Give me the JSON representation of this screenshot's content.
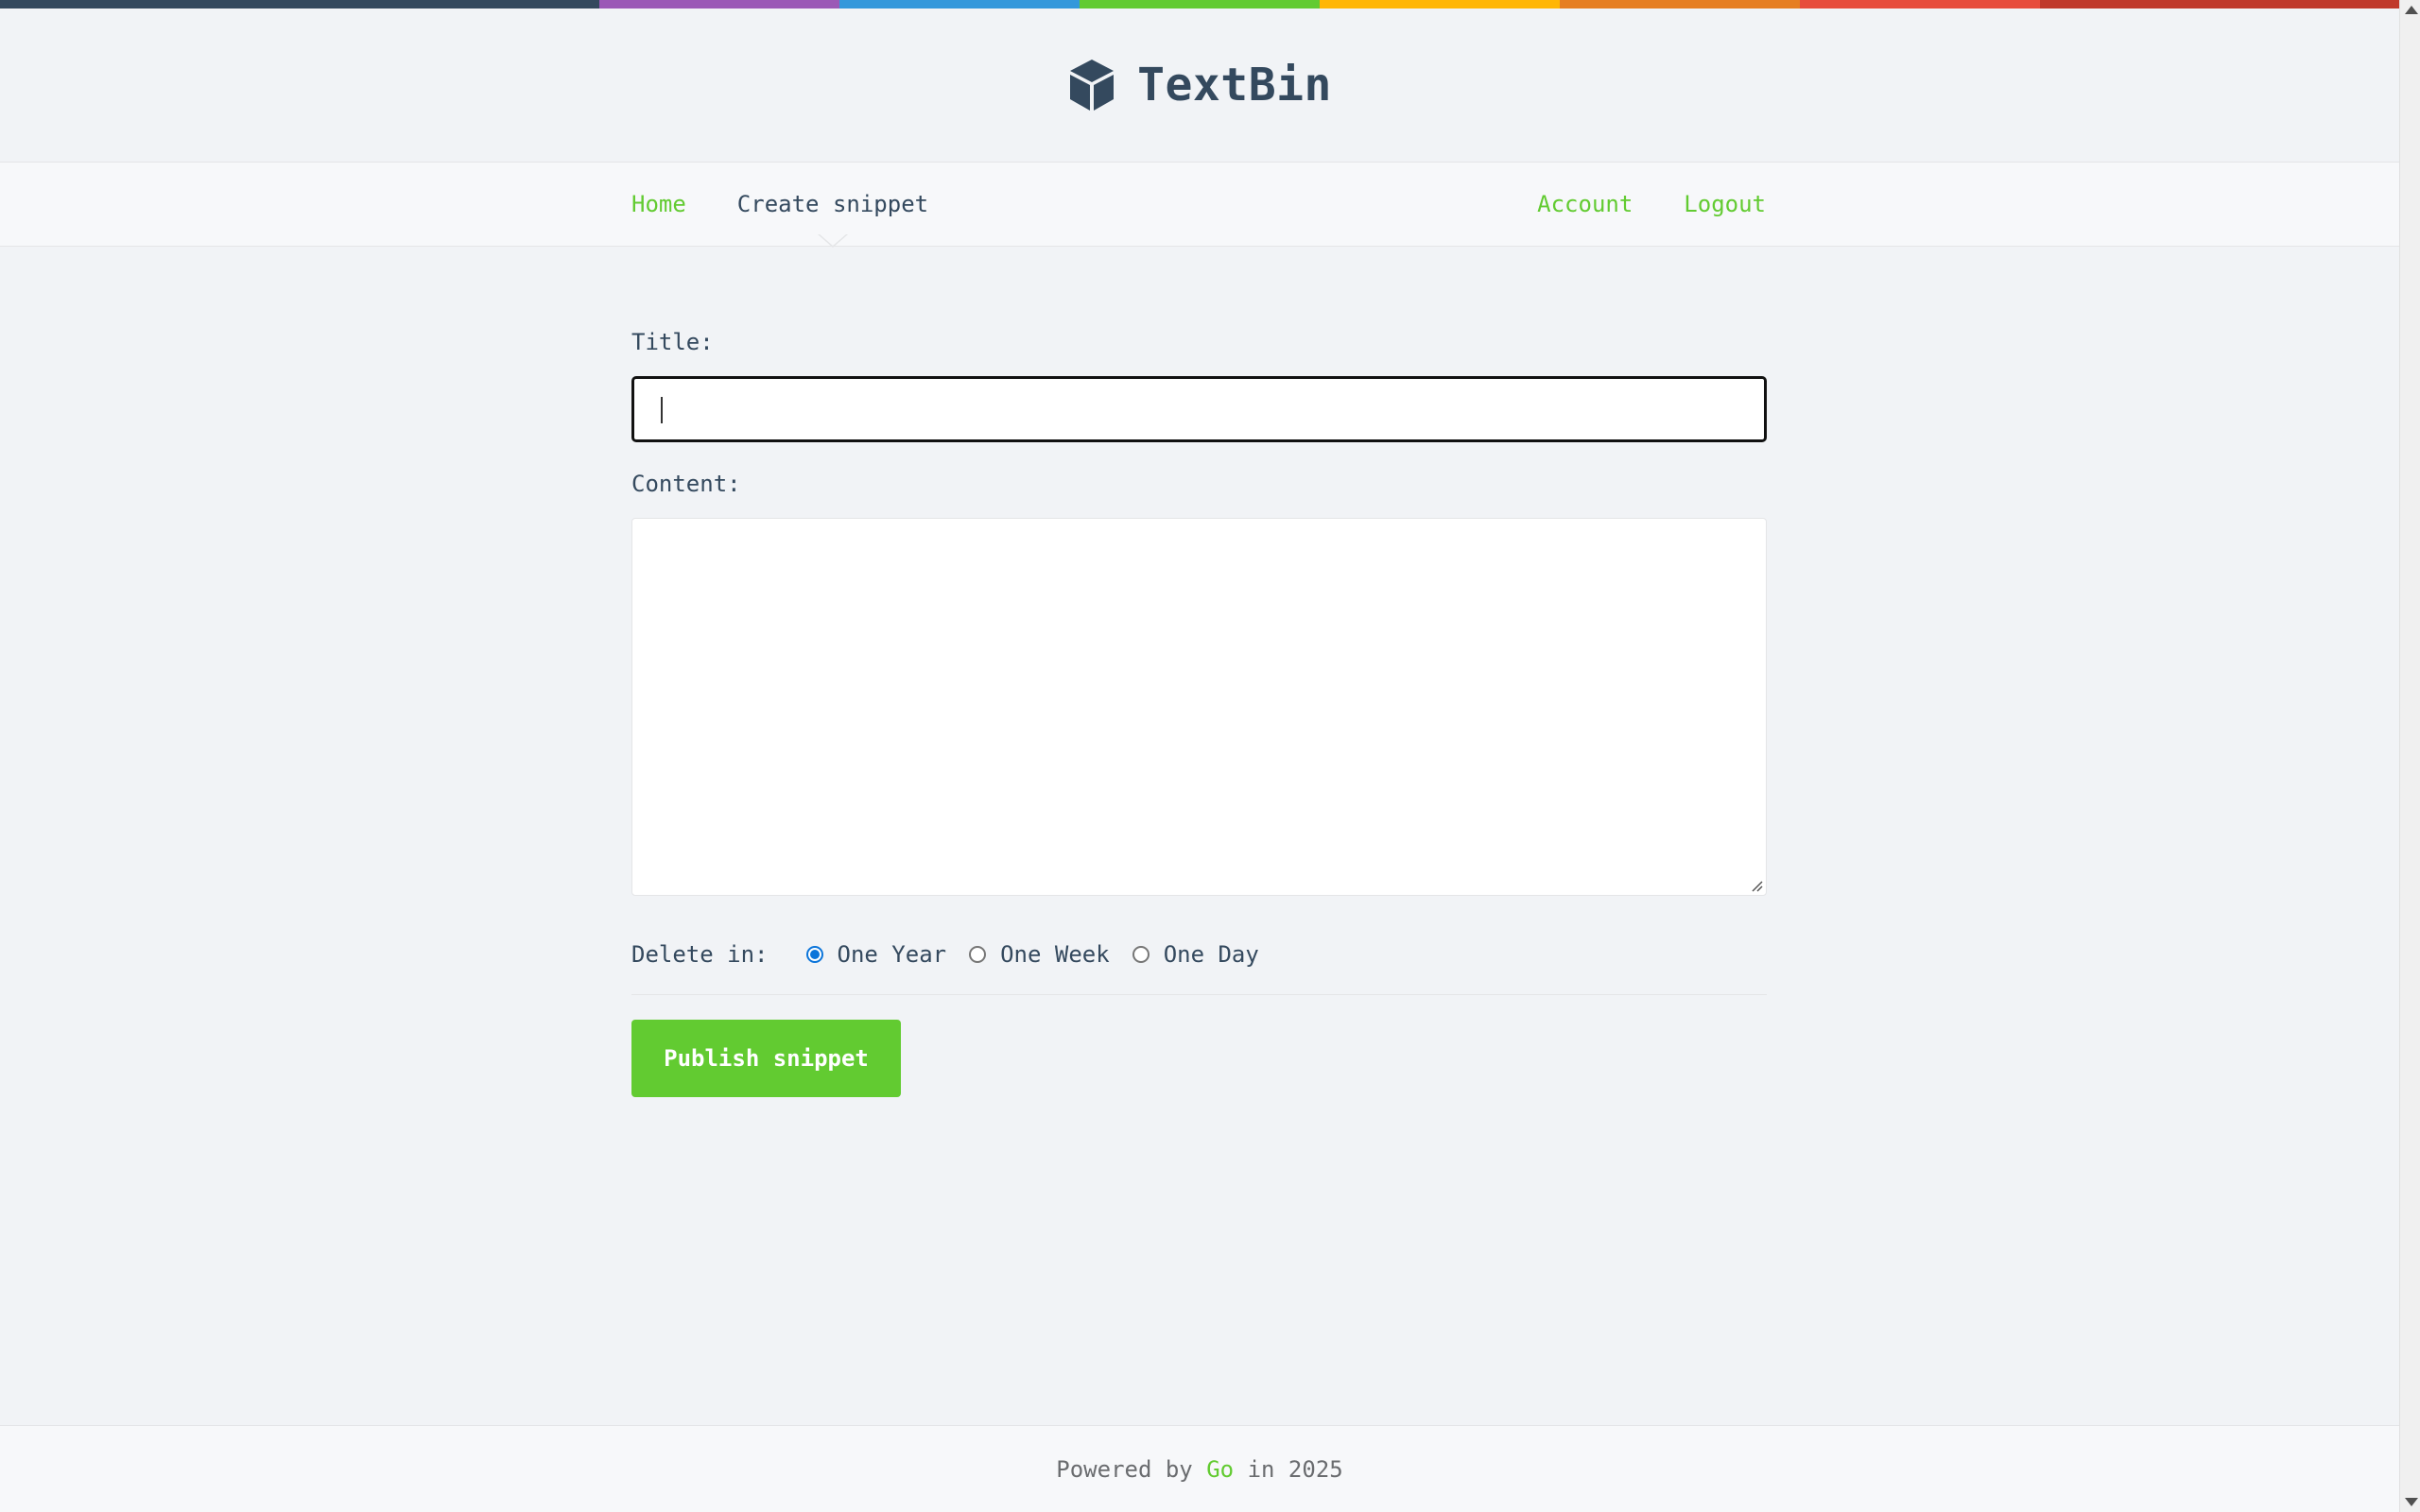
{
  "stripe_colors": [
    "#34495e",
    "#9b59b6",
    "#3498db",
    "#62cb31",
    "#ffb606",
    "#e67e22",
    "#e74c3c",
    "#c0392b"
  ],
  "header": {
    "logo_text": "TextBin",
    "logo_icon": "cube-icon"
  },
  "nav": {
    "left": [
      {
        "label": "Home",
        "active": false
      },
      {
        "label": "Create snippet",
        "active": true
      }
    ],
    "right": [
      {
        "label": "Account"
      },
      {
        "label": "Logout"
      }
    ]
  },
  "form": {
    "title_label": "Title:",
    "title_value": "",
    "content_label": "Content:",
    "content_value": "",
    "delete_label": "Delete in:",
    "expiry_options": [
      {
        "label": "One Year",
        "checked": true
      },
      {
        "label": "One Week",
        "checked": false
      },
      {
        "label": "One Day",
        "checked": false
      }
    ],
    "publish_label": "Publish snippet"
  },
  "footer": {
    "prefix": "Powered by",
    "link": "Go",
    "suffix": "in 2025"
  },
  "colors": {
    "accent": "#62cb31",
    "text": "#34495e",
    "radio_checked": "#0a74da"
  }
}
